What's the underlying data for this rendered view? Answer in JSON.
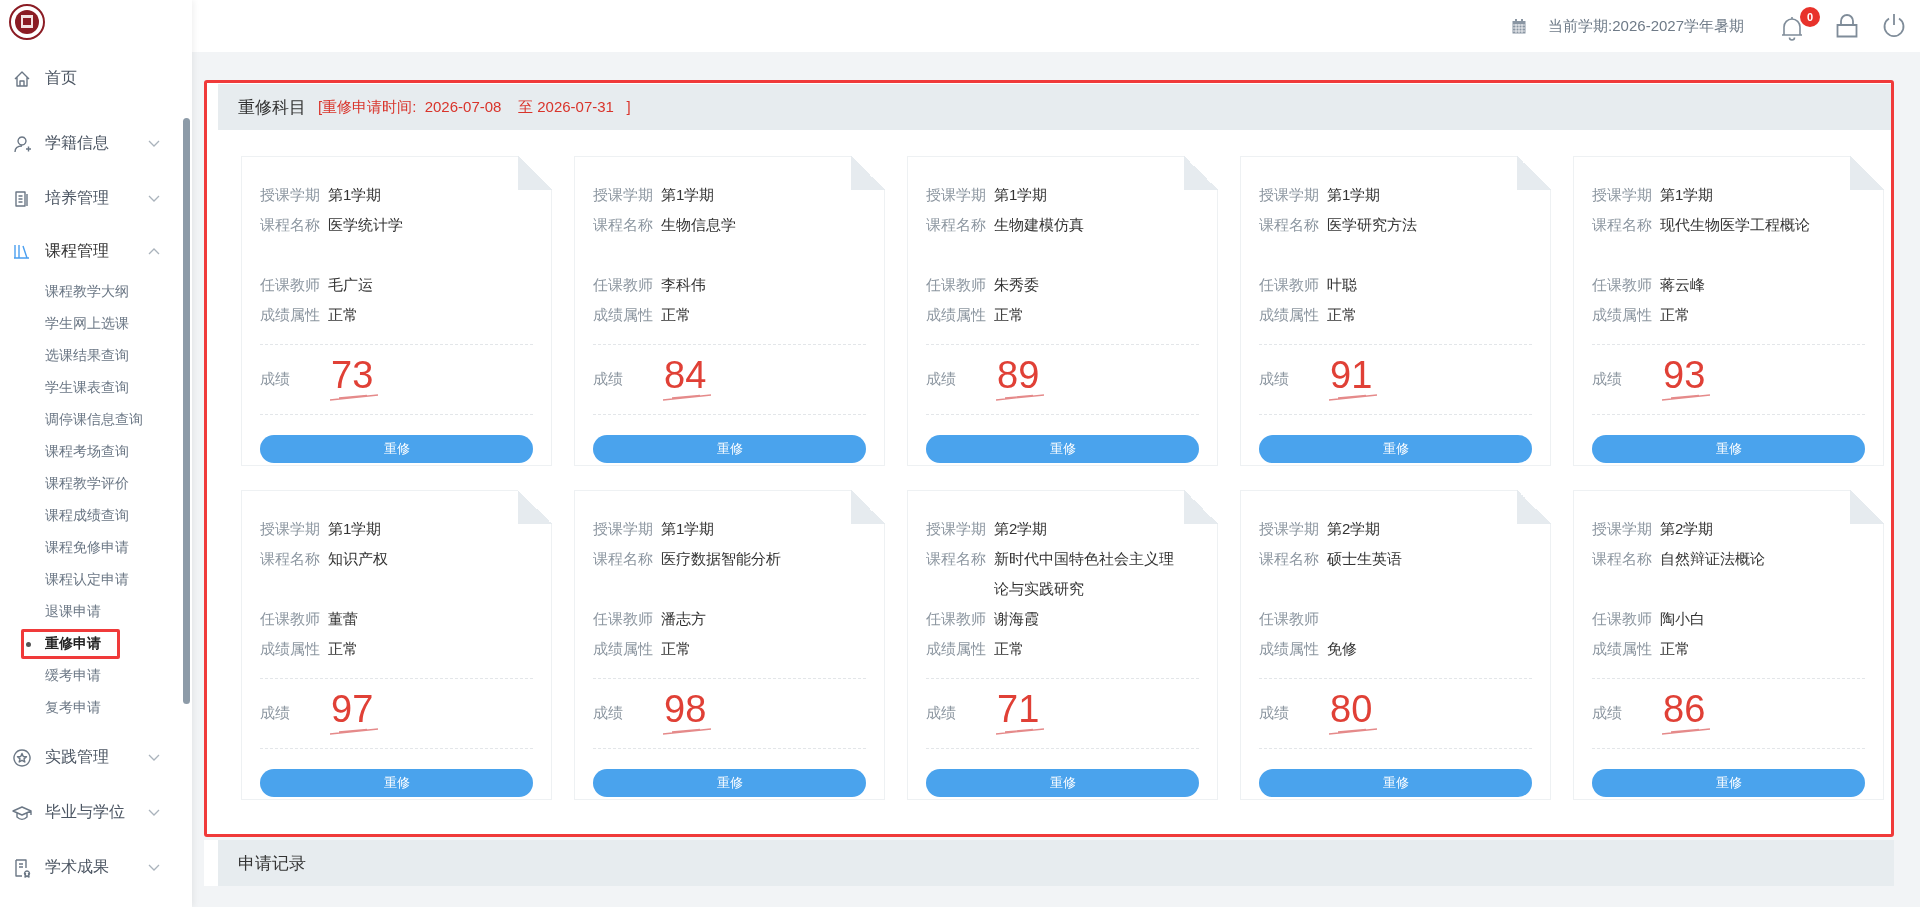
{
  "header": {
    "term": "当前学期:2026-2027学年暑期",
    "notification_count": "0"
  },
  "sidebar": {
    "items": [
      {
        "label": "首页",
        "kind": "link",
        "expanded": false
      },
      {
        "label": "学籍信息",
        "kind": "group",
        "expanded": false
      },
      {
        "label": "培养管理",
        "kind": "group",
        "expanded": false
      },
      {
        "label": "课程管理",
        "kind": "group",
        "expanded": true,
        "children": [
          {
            "label": "课程教学大纲",
            "selected": false
          },
          {
            "label": "学生网上选课",
            "selected": false
          },
          {
            "label": "选课结果查询",
            "selected": false
          },
          {
            "label": "学生课表查询",
            "selected": false
          },
          {
            "label": "调停课信息查询",
            "selected": false
          },
          {
            "label": "课程考场查询",
            "selected": false
          },
          {
            "label": "课程教学评价",
            "selected": false
          },
          {
            "label": "课程成绩查询",
            "selected": false
          },
          {
            "label": "课程免修申请",
            "selected": false
          },
          {
            "label": "课程认定申请",
            "selected": false
          },
          {
            "label": "退课申请",
            "selected": false
          },
          {
            "label": "重修申请",
            "selected": true
          },
          {
            "label": "缓考申请",
            "selected": false
          },
          {
            "label": "复考申请",
            "selected": false
          }
        ]
      },
      {
        "label": "实践管理",
        "kind": "group",
        "expanded": false
      },
      {
        "label": "毕业与学位",
        "kind": "group",
        "expanded": false
      },
      {
        "label": "学术成果",
        "kind": "group",
        "expanded": false
      }
    ]
  },
  "retake_section": {
    "title": "重修科目",
    "period": "[重修申请时间:  2026-07-08    至 2026-07-31   ]",
    "highlighted": true,
    "cards": [
      {
        "fields": [
          {
            "label": "授课学期",
            "value": "第1学期"
          },
          {
            "label": "课程名称",
            "value": "医学统计学"
          },
          {
            "label": "任课教师",
            "value": "毛广运"
          },
          {
            "label": "成绩属性",
            "value": "正常"
          }
        ],
        "score_label": "成绩",
        "score": "73",
        "button": "重修"
      },
      {
        "fields": [
          {
            "label": "授课学期",
            "value": "第1学期"
          },
          {
            "label": "课程名称",
            "value": "生物信息学"
          },
          {
            "label": "任课教师",
            "value": "李科伟"
          },
          {
            "label": "成绩属性",
            "value": "正常"
          }
        ],
        "score_label": "成绩",
        "score": "84",
        "button": "重修"
      },
      {
        "fields": [
          {
            "label": "授课学期",
            "value": "第1学期"
          },
          {
            "label": "课程名称",
            "value": "生物建模仿真"
          },
          {
            "label": "任课教师",
            "value": "朱秀委"
          },
          {
            "label": "成绩属性",
            "value": "正常"
          }
        ],
        "score_label": "成绩",
        "score": "89",
        "button": "重修"
      },
      {
        "fields": [
          {
            "label": "授课学期",
            "value": "第1学期"
          },
          {
            "label": "课程名称",
            "value": "医学研究方法"
          },
          {
            "label": "任课教师",
            "value": "叶聪"
          },
          {
            "label": "成绩属性",
            "value": "正常"
          }
        ],
        "score_label": "成绩",
        "score": "91",
        "button": "重修"
      },
      {
        "fields": [
          {
            "label": "授课学期",
            "value": "第1学期"
          },
          {
            "label": "课程名称",
            "value": "现代生物医学工程概论"
          },
          {
            "label": "任课教师",
            "value": "蒋云峰"
          },
          {
            "label": "成绩属性",
            "value": "正常"
          }
        ],
        "score_label": "成绩",
        "score": "93",
        "button": "重修"
      },
      {
        "fields": [
          {
            "label": "授课学期",
            "value": "第1学期"
          },
          {
            "label": "课程名称",
            "value": "知识产权"
          },
          {
            "label": "任课教师",
            "value": "董蕾"
          },
          {
            "label": "成绩属性",
            "value": "正常"
          }
        ],
        "score_label": "成绩",
        "score": "97",
        "button": "重修"
      },
      {
        "fields": [
          {
            "label": "授课学期",
            "value": "第1学期"
          },
          {
            "label": "课程名称",
            "value": "医疗数据智能分析"
          },
          {
            "label": "任课教师",
            "value": "潘志方"
          },
          {
            "label": "成绩属性",
            "value": "正常"
          }
        ],
        "score_label": "成绩",
        "score": "98",
        "button": "重修"
      },
      {
        "fields": [
          {
            "label": "授课学期",
            "value": "第2学期"
          },
          {
            "label": "课程名称",
            "value": "新时代中国特色社会主义理论与实践研究"
          },
          {
            "label": "任课教师",
            "value": "谢海霞"
          },
          {
            "label": "成绩属性",
            "value": "正常"
          }
        ],
        "score_label": "成绩",
        "score": "71",
        "button": "重修"
      },
      {
        "fields": [
          {
            "label": "授课学期",
            "value": "第2学期"
          },
          {
            "label": "课程名称",
            "value": "硕士生英语"
          },
          {
            "label": "任课教师"
          },
          {
            "label": "成绩属性",
            "value": "免修"
          }
        ],
        "score_label": "成绩",
        "score": "80",
        "button": "重修"
      },
      {
        "fields": [
          {
            "label": "授课学期",
            "value": "第2学期"
          },
          {
            "label": "课程名称",
            "value": "自然辩证法概论"
          },
          {
            "label": "任课教师",
            "value": "陶小白"
          },
          {
            "label": "成绩属性",
            "value": "正常"
          }
        ],
        "score_label": "成绩",
        "score": "86",
        "button": "重修"
      }
    ]
  },
  "records_section": {
    "title": "申请记录"
  }
}
